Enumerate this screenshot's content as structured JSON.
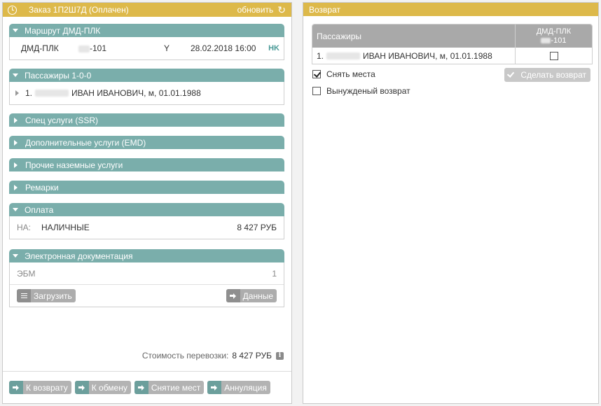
{
  "order": {
    "title": "Заказ 1П2Ш7Д (Оплачен)",
    "refresh_label": "обновить"
  },
  "route": {
    "header": "Маршрут ДМД-ПЛК",
    "segment": "ДМД-ПЛК",
    "flight_suffix": "-101",
    "class": "Y",
    "datetime": "28.02.2018 16:00",
    "status": "HK"
  },
  "passengers": {
    "header": "Пассажиры 1-0-0",
    "items": [
      {
        "index": "1.",
        "name": "ИВАН ИВАНОВИЧ, м, 01.01.1988"
      }
    ]
  },
  "sections": {
    "ssr": "Спец услуги (SSR)",
    "emd": "Дополнительные услуги (EMD)",
    "ground": "Прочие наземные услуги",
    "remarks": "Ремарки"
  },
  "payment": {
    "header": "Оплата",
    "code": "НА:",
    "type": "НАЛИЧНЫЕ",
    "amount": "8 427 РУБ"
  },
  "edoc": {
    "header": "Электронная документация",
    "label": "ЭБМ",
    "count": "1",
    "upload_label": "Загрузить",
    "data_label": "Данные"
  },
  "cost": {
    "label": "Стоимость перевозки:",
    "value": "8 427 РУБ"
  },
  "footer": {
    "to_return": "К возврату",
    "to_exchange": "К обмену",
    "unseat": "Снятие мест",
    "cancel": "Аннуляция"
  },
  "refund": {
    "header": "Возврат",
    "col_passengers": "Пассажиры",
    "col_segment_line1": "ДМД-ПЛК",
    "col_segment_line2": "-101",
    "row_index": "1.",
    "row_name": "ИВАН ИВАНОВИЧ, м, 01.01.1988",
    "opt_unseat": "Снять места",
    "opt_forced": "Вынужденый возврат",
    "do_refund": "Сделать возврат",
    "opt_unseat_checked": true,
    "opt_forced_checked": false
  }
}
